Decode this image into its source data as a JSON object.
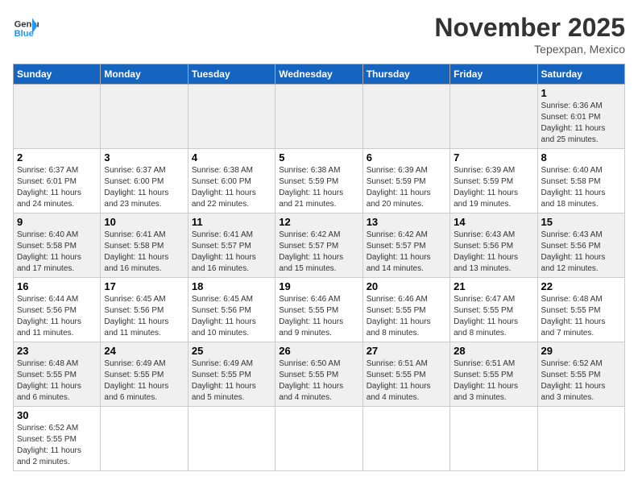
{
  "header": {
    "logo_general": "General",
    "logo_blue": "Blue",
    "month_title": "November 2025",
    "location": "Tepexpan, Mexico"
  },
  "weekdays": [
    "Sunday",
    "Monday",
    "Tuesday",
    "Wednesday",
    "Thursday",
    "Friday",
    "Saturday"
  ],
  "weeks": [
    [
      {
        "day": "",
        "info": ""
      },
      {
        "day": "",
        "info": ""
      },
      {
        "day": "",
        "info": ""
      },
      {
        "day": "",
        "info": ""
      },
      {
        "day": "",
        "info": ""
      },
      {
        "day": "",
        "info": ""
      },
      {
        "day": "1",
        "info": "Sunrise: 6:36 AM\nSunset: 6:01 PM\nDaylight: 11 hours\nand 25 minutes."
      }
    ],
    [
      {
        "day": "2",
        "info": "Sunrise: 6:37 AM\nSunset: 6:01 PM\nDaylight: 11 hours\nand 24 minutes."
      },
      {
        "day": "3",
        "info": "Sunrise: 6:37 AM\nSunset: 6:00 PM\nDaylight: 11 hours\nand 23 minutes."
      },
      {
        "day": "4",
        "info": "Sunrise: 6:38 AM\nSunset: 6:00 PM\nDaylight: 11 hours\nand 22 minutes."
      },
      {
        "day": "5",
        "info": "Sunrise: 6:38 AM\nSunset: 5:59 PM\nDaylight: 11 hours\nand 21 minutes."
      },
      {
        "day": "6",
        "info": "Sunrise: 6:39 AM\nSunset: 5:59 PM\nDaylight: 11 hours\nand 20 minutes."
      },
      {
        "day": "7",
        "info": "Sunrise: 6:39 AM\nSunset: 5:59 PM\nDaylight: 11 hours\nand 19 minutes."
      },
      {
        "day": "8",
        "info": "Sunrise: 6:40 AM\nSunset: 5:58 PM\nDaylight: 11 hours\nand 18 minutes."
      }
    ],
    [
      {
        "day": "9",
        "info": "Sunrise: 6:40 AM\nSunset: 5:58 PM\nDaylight: 11 hours\nand 17 minutes."
      },
      {
        "day": "10",
        "info": "Sunrise: 6:41 AM\nSunset: 5:58 PM\nDaylight: 11 hours\nand 16 minutes."
      },
      {
        "day": "11",
        "info": "Sunrise: 6:41 AM\nSunset: 5:57 PM\nDaylight: 11 hours\nand 16 minutes."
      },
      {
        "day": "12",
        "info": "Sunrise: 6:42 AM\nSunset: 5:57 PM\nDaylight: 11 hours\nand 15 minutes."
      },
      {
        "day": "13",
        "info": "Sunrise: 6:42 AM\nSunset: 5:57 PM\nDaylight: 11 hours\nand 14 minutes."
      },
      {
        "day": "14",
        "info": "Sunrise: 6:43 AM\nSunset: 5:56 PM\nDaylight: 11 hours\nand 13 minutes."
      },
      {
        "day": "15",
        "info": "Sunrise: 6:43 AM\nSunset: 5:56 PM\nDaylight: 11 hours\nand 12 minutes."
      }
    ],
    [
      {
        "day": "16",
        "info": "Sunrise: 6:44 AM\nSunset: 5:56 PM\nDaylight: 11 hours\nand 11 minutes."
      },
      {
        "day": "17",
        "info": "Sunrise: 6:45 AM\nSunset: 5:56 PM\nDaylight: 11 hours\nand 11 minutes."
      },
      {
        "day": "18",
        "info": "Sunrise: 6:45 AM\nSunset: 5:56 PM\nDaylight: 11 hours\nand 10 minutes."
      },
      {
        "day": "19",
        "info": "Sunrise: 6:46 AM\nSunset: 5:55 PM\nDaylight: 11 hours\nand 9 minutes."
      },
      {
        "day": "20",
        "info": "Sunrise: 6:46 AM\nSunset: 5:55 PM\nDaylight: 11 hours\nand 8 minutes."
      },
      {
        "day": "21",
        "info": "Sunrise: 6:47 AM\nSunset: 5:55 PM\nDaylight: 11 hours\nand 8 minutes."
      },
      {
        "day": "22",
        "info": "Sunrise: 6:48 AM\nSunset: 5:55 PM\nDaylight: 11 hours\nand 7 minutes."
      }
    ],
    [
      {
        "day": "23",
        "info": "Sunrise: 6:48 AM\nSunset: 5:55 PM\nDaylight: 11 hours\nand 6 minutes."
      },
      {
        "day": "24",
        "info": "Sunrise: 6:49 AM\nSunset: 5:55 PM\nDaylight: 11 hours\nand 6 minutes."
      },
      {
        "day": "25",
        "info": "Sunrise: 6:49 AM\nSunset: 5:55 PM\nDaylight: 11 hours\nand 5 minutes."
      },
      {
        "day": "26",
        "info": "Sunrise: 6:50 AM\nSunset: 5:55 PM\nDaylight: 11 hours\nand 4 minutes."
      },
      {
        "day": "27",
        "info": "Sunrise: 6:51 AM\nSunset: 5:55 PM\nDaylight: 11 hours\nand 4 minutes."
      },
      {
        "day": "28",
        "info": "Sunrise: 6:51 AM\nSunset: 5:55 PM\nDaylight: 11 hours\nand 3 minutes."
      },
      {
        "day": "29",
        "info": "Sunrise: 6:52 AM\nSunset: 5:55 PM\nDaylight: 11 hours\nand 3 minutes."
      }
    ],
    [
      {
        "day": "30",
        "info": "Sunrise: 6:52 AM\nSunset: 5:55 PM\nDaylight: 11 hours\nand 2 minutes."
      },
      {
        "day": "",
        "info": ""
      },
      {
        "day": "",
        "info": ""
      },
      {
        "day": "",
        "info": ""
      },
      {
        "day": "",
        "info": ""
      },
      {
        "day": "",
        "info": ""
      },
      {
        "day": "",
        "info": ""
      }
    ]
  ]
}
